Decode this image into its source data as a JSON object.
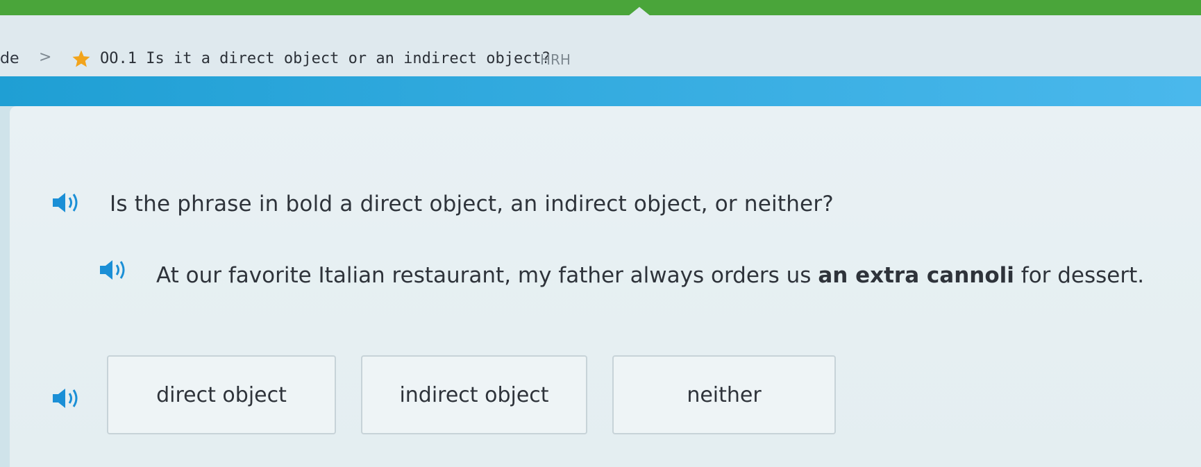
{
  "breadcrumb": {
    "previous": "de",
    "separator": ">",
    "title": "OO.1 Is it a direct object or an indirect object?",
    "code": "HRH"
  },
  "question": {
    "prompt": "Is the phrase in bold a direct object, an indirect object, or neither?",
    "sentence_before": "At our favorite Italian restaurant, my father always orders us ",
    "sentence_bold": "an extra cannoli",
    "sentence_after": " for dessert."
  },
  "choices": [
    {
      "label": "direct object"
    },
    {
      "label": "indirect object"
    },
    {
      "label": "neither"
    }
  ],
  "colors": {
    "top_bar": "#4aa53a",
    "band": "#1f9fd4",
    "star": "#f2a41c",
    "speaker": "#1b8fd6"
  },
  "icons": {
    "star": "star-icon",
    "speaker": "speaker-icon"
  }
}
